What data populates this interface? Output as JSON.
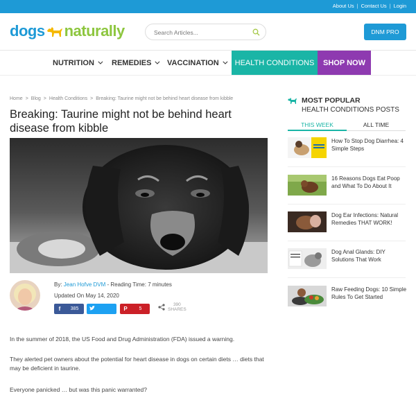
{
  "topbar": {
    "links": [
      "About Us",
      "Contact Us",
      "Login"
    ],
    "separator": "|"
  },
  "header": {
    "logo_left": "dogs",
    "logo_right": "naturally",
    "search_placeholder": "Search Articles...",
    "cta_label": "DNM PRO"
  },
  "nav": {
    "items": [
      "NUTRITION",
      "REMEDIES",
      "VACCINATION"
    ],
    "highlight": "HEALTH CONDITIONS",
    "shop": "SHOP NOW"
  },
  "breadcrumb": {
    "items": [
      "Home",
      "Blog",
      "Health Conditions",
      "Breaking: Taurine might not be behind heart disease from kibble"
    ],
    "separator": ">"
  },
  "article": {
    "title": "Breaking: Taurine might not be behind heart disease from kibble",
    "by_prefix": "By:",
    "author": "Jean Hofve DVM",
    "reading_time": "- Reading Time: 7 minutes",
    "updated": "Updated On May 14, 2020",
    "shares": {
      "facebook_count": "385",
      "pinterest_count": "5",
      "total": "390",
      "total_label": "SHARES"
    },
    "paragraphs": [
      "In the summer of 2018, the US Food and Drug Administration (FDA) issued a warning.",
      "They alerted pet owners about the potential for heart disease in dogs on certain diets … diets that may be deficient in taurine.",
      "Everyone panicked … but was this panic warranted?"
    ]
  },
  "sidebar": {
    "heading_line1": "MOST POPULAR",
    "heading_line2": "HEALTH CONDITIONS POSTS",
    "tabs": [
      "THIS WEEK",
      "ALL TIME"
    ],
    "posts": [
      {
        "title": "How To Stop Dog Diarrhea: 4 Simple Steps"
      },
      {
        "title": "16 Reasons Dogs Eat Poop and What To Do About It"
      },
      {
        "title": "Dog Ear Infections: Natural Remedies THAT WORK!"
      },
      {
        "title": "Dog Anal Glands: DIY Solutions That Work"
      },
      {
        "title": "Raw Feeding Dogs: 10 Simple Rules To Get Started"
      }
    ]
  },
  "colors": {
    "brand_blue": "#1e9ad6",
    "brand_green": "#8dc63f",
    "teal": "#1ab5a6",
    "purple": "#8e3ab0"
  }
}
